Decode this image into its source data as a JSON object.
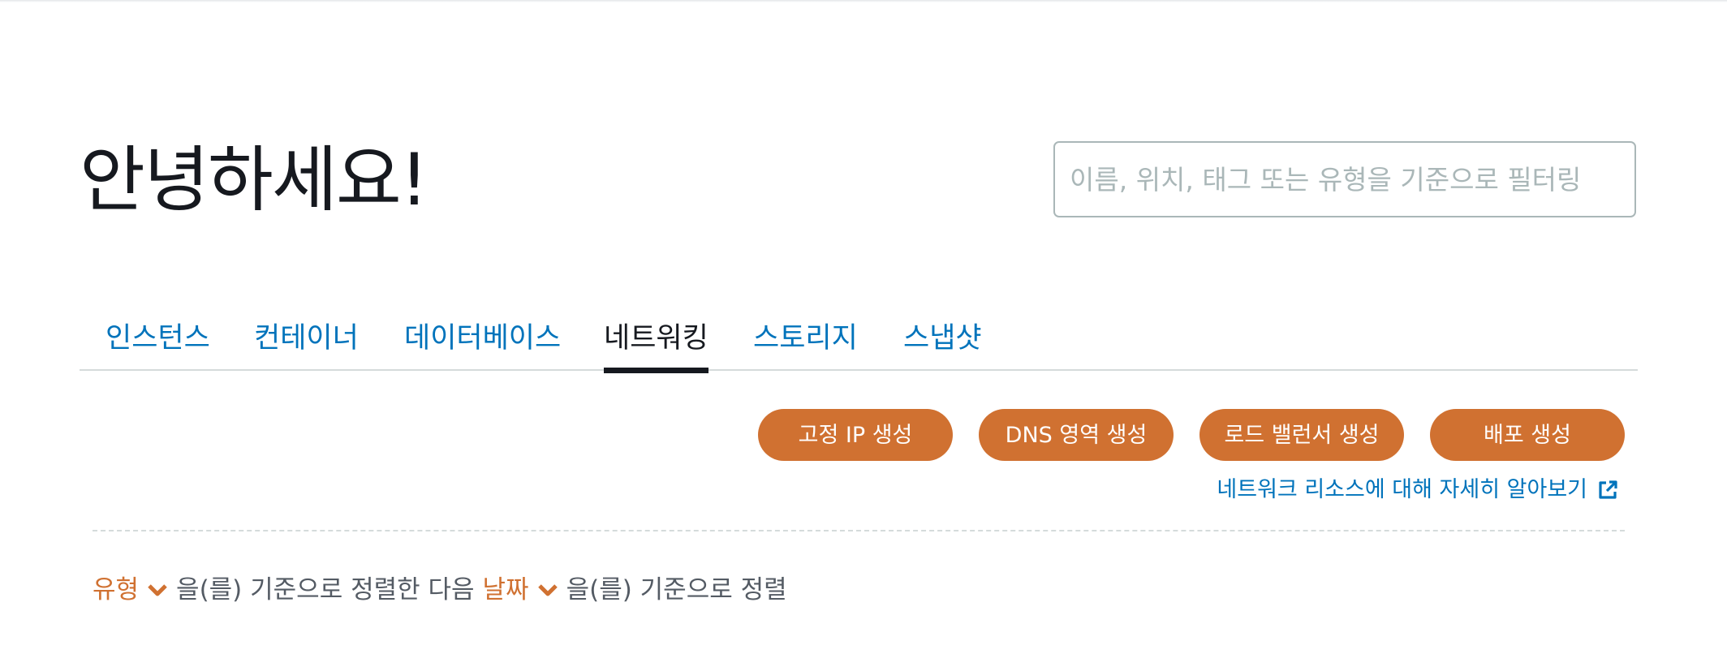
{
  "greeting": "안녕하세요!",
  "search": {
    "placeholder": "이름, 위치, 태그 또는 유형을 기준으로 필터링"
  },
  "tabs": [
    {
      "label": "인스턴스",
      "active": false
    },
    {
      "label": "컨테이너",
      "active": false
    },
    {
      "label": "데이터베이스",
      "active": false
    },
    {
      "label": "네트워킹",
      "active": true
    },
    {
      "label": "스토리지",
      "active": false
    },
    {
      "label": "스냅샷",
      "active": false
    }
  ],
  "actions": [
    {
      "label": "고정 IP 생성"
    },
    {
      "label": "DNS 영역 생성"
    },
    {
      "label": "로드 밸런서 생성"
    },
    {
      "label": "배포 생성"
    }
  ],
  "learn_link": {
    "label": "네트워크 리소스에 대해 자세히 알아보기",
    "icon": "external-link-icon"
  },
  "sort": {
    "primary": "유형",
    "connector1": "을(를) 기준으로 정렬한 다음",
    "secondary": "날짜",
    "connector2": "을(를) 기준으로 정렬"
  },
  "colors": {
    "accent": "#d07131",
    "link": "#0073bb",
    "text": "#16191f"
  }
}
